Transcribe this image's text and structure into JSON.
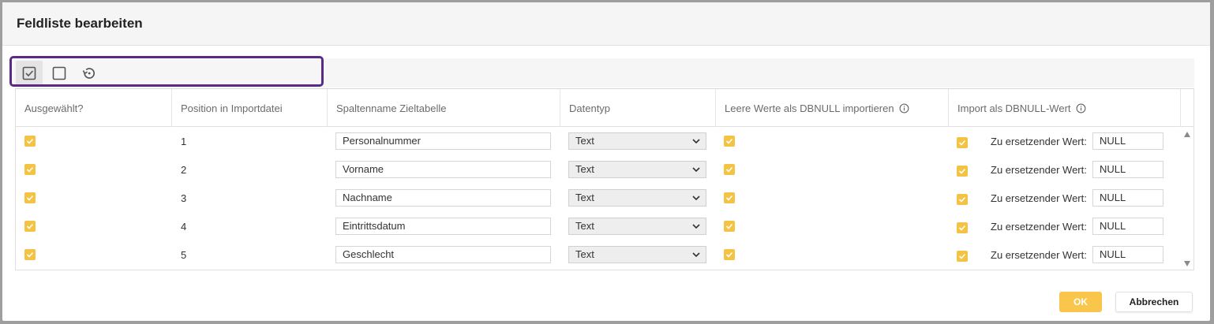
{
  "dialog": {
    "title": "Feldliste bearbeiten"
  },
  "toolbar": {
    "buttons": [
      {
        "icon": "select-all-checkbox-icon",
        "active": true
      },
      {
        "icon": "deselect-all-checkbox-icon",
        "active": false
      },
      {
        "icon": "reset-history-icon",
        "active": false
      }
    ]
  },
  "grid": {
    "columns": [
      "Ausgewählt?",
      "Position in Importdatei",
      "Spaltenname Zieltabelle",
      "Datentyp",
      "Leere Werte als DBNULL importieren",
      "Import als DBNULL-Wert"
    ],
    "replace_label": "Zu ersetzender Wert:",
    "rows": [
      {
        "selected": true,
        "position": "1",
        "column_name": "Personalnummer",
        "datatype": "Text",
        "empty_as_null": true,
        "import_null": true,
        "null_value": "NULL"
      },
      {
        "selected": true,
        "position": "2",
        "column_name": "Vorname",
        "datatype": "Text",
        "empty_as_null": true,
        "import_null": true,
        "null_value": "NULL"
      },
      {
        "selected": true,
        "position": "3",
        "column_name": "Nachname",
        "datatype": "Text",
        "empty_as_null": true,
        "import_null": true,
        "null_value": "NULL"
      },
      {
        "selected": true,
        "position": "4",
        "column_name": "Eintrittsdatum",
        "datatype": "Text",
        "empty_as_null": true,
        "import_null": true,
        "null_value": "NULL"
      },
      {
        "selected": true,
        "position": "5",
        "column_name": "Geschlecht",
        "datatype": "Text",
        "empty_as_null": true,
        "import_null": true,
        "null_value": "NULL"
      }
    ]
  },
  "footer": {
    "ok_label": "OK",
    "cancel_label": "Abbrechen"
  },
  "colors": {
    "accent": "#f9c54a",
    "checkbox": "#f5c343",
    "highlight_border": "#5b2a86"
  }
}
